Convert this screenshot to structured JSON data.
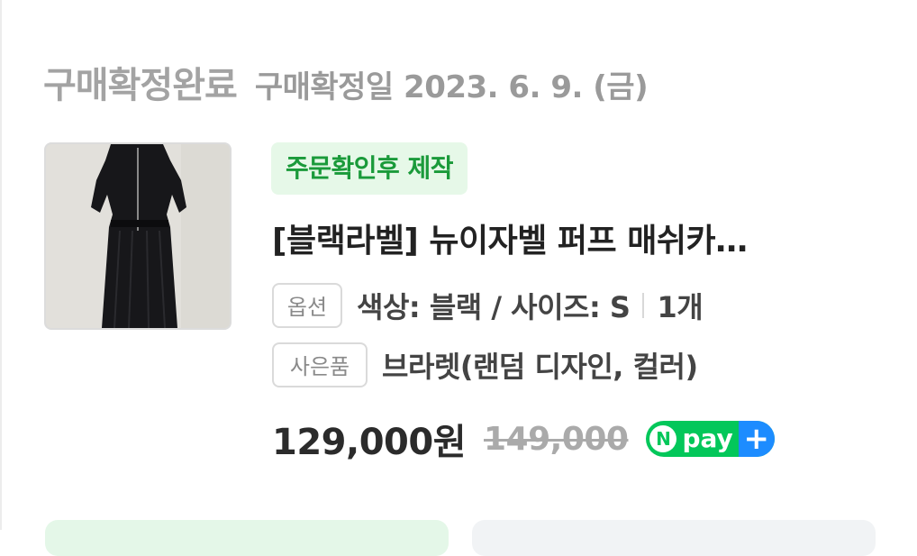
{
  "order": {
    "status": "구매확정완료",
    "confirm_date": "구매확정일 2023. 6. 9. (금)"
  },
  "product": {
    "badge": "주문확인후 제작",
    "title": "[블랙라벨] 뉴이자벨 퍼프 매쉬카…",
    "option_tag": "옵션",
    "option_text": "색상: 블랙 / 사이즈: S",
    "quantity": "1개",
    "gift_tag": "사은품",
    "gift_text": "브라렛(랜덤 디자인, 컬러)",
    "price": "129,000원",
    "original_price": "149,000",
    "npay": {
      "n": "N",
      "label": "pay",
      "plus": "+"
    }
  },
  "colors": {
    "status_gray": "#a3a3a3",
    "badge_green": "#1a9a3a",
    "badge_bg": "#e6f8e8",
    "npay_green": "#03c75a",
    "npay_blue": "#1d8cff"
  },
  "icons": {
    "thumbnail": "product-image-black-dress"
  }
}
